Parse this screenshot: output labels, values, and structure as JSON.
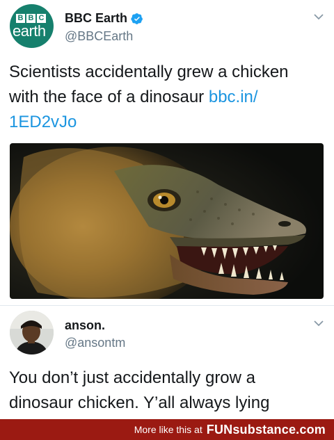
{
  "tweet1": {
    "avatar": {
      "bbc_letters": [
        "B",
        "B",
        "C"
      ],
      "wordmark": "earth",
      "bg_color": "#16806d"
    },
    "display_name": "BBC Earth",
    "handle": "@BBCEarth",
    "verified_icon": "verified-badge-icon",
    "menu_icon": "chevron-down-icon",
    "text_line1": "Scientists accidentally grew a chicken",
    "text_line2_plain": "with the face of a dinosaur ",
    "link_part1": "bbc.in/",
    "link_part2": "1ED2vJo",
    "media_description_icon": "dinosaur-chicken-photo"
  },
  "tweet2": {
    "display_name": "anson.",
    "handle": "@ansontm",
    "menu_icon": "chevron-down-icon",
    "text_line1": "You don’t just accidentally grow a",
    "text_line2": "dinosaur chicken. Y’all always lying"
  },
  "footer": {
    "text": "More like this at",
    "brand": "FUNsubstance.com",
    "bg_color": "#9b1a12"
  },
  "colors": {
    "link": "#1b95e0",
    "handle": "#657786",
    "verified": "#1da1f2"
  }
}
